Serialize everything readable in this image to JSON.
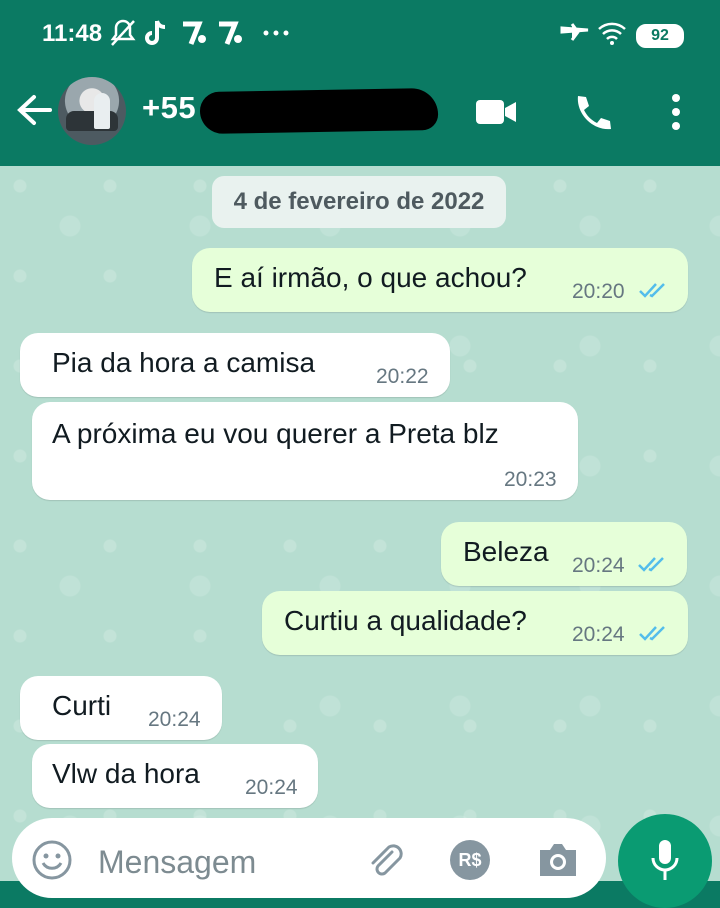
{
  "status_bar": {
    "time": "11:48",
    "battery": "92"
  },
  "header": {
    "contact": "+55"
  },
  "chat": {
    "date": "4 de fevereiro de 2022",
    "messages": [
      {
        "dir": "out",
        "text": "E aí irmão, o que achou?",
        "time": "20:20",
        "read": true
      },
      {
        "dir": "in",
        "text": "Pia da hora a camisa",
        "time": "20:22"
      },
      {
        "dir": "in",
        "text": "A próxima eu vou querer a Preta blz",
        "time": "20:23"
      },
      {
        "dir": "out",
        "text": "Beleza",
        "time": "20:24",
        "read": true
      },
      {
        "dir": "out",
        "text": "Curtiu a qualidade?",
        "time": "20:24",
        "read": true
      },
      {
        "dir": "in",
        "text": "Curti",
        "time": "20:24"
      },
      {
        "dir": "in",
        "text": "Vlw da hora",
        "time": "20:24"
      }
    ]
  },
  "composer": {
    "placeholder": "Mensagem",
    "currency": "R$"
  },
  "colors": {
    "header": "#0b7a63",
    "outgoing": "#e6ffd9",
    "incoming": "#ffffff",
    "chat_bg": "#b6ddd0",
    "read_ticks": "#53bdeb"
  }
}
